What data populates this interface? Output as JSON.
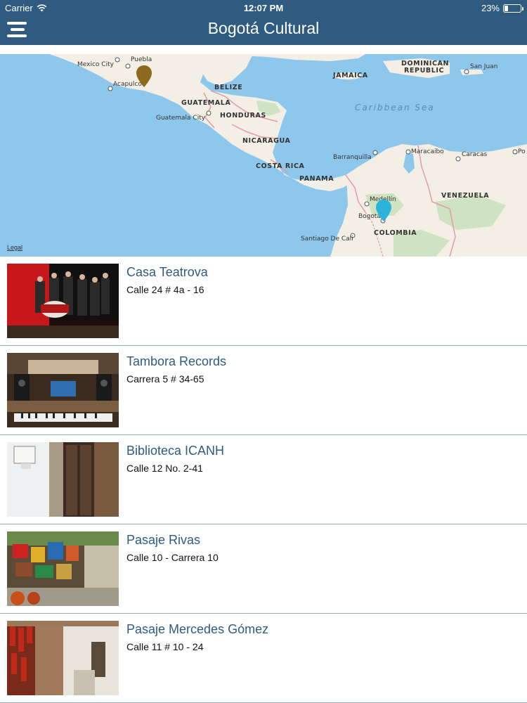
{
  "status_bar": {
    "carrier": "Carrier",
    "time": "12:07 PM",
    "battery": "23%",
    "battery_level": 0.23
  },
  "header": {
    "title": "Bogotá Cultural",
    "menu_icon": "hamburger-menu-icon"
  },
  "map": {
    "legal_label": "Legal",
    "sea_label": "Caribbean Sea",
    "countries": [
      "BELIZE",
      "GUATEMALA",
      "HONDURAS",
      "NICARAGUA",
      "COSTA RICA",
      "PANAMA",
      "JAMAICA",
      "DOMINICAN",
      "REPUBLIC",
      "VENEZUELA",
      "COLOMBIA"
    ],
    "cities": [
      "Mexico City",
      "Puebla",
      "Acapulco",
      "Guatemala City",
      "San Juan",
      "Barranquilla",
      "Maracaibo",
      "Caracas",
      "Po",
      "Medellín",
      "Bogotá",
      "Santiago De Cali"
    ]
  },
  "colors": {
    "header": "#2f5b80",
    "accent_title": "#2f5b80",
    "pin_gold": "#8b6a1e",
    "pin_blue": "#2bb3dc",
    "water": "#8ec7ec",
    "land": "#f3efe4"
  },
  "places": [
    {
      "name": "Casa Teatrova",
      "address": "Calle 24 # 4a - 16"
    },
    {
      "name": "Tambora Records",
      "address": "Carrera 5 # 34-65"
    },
    {
      "name": "Biblioteca ICANH",
      "address": "Calle 12 No. 2-41"
    },
    {
      "name": "Pasaje Rivas",
      "address": "Calle 10 - Carrera 10"
    },
    {
      "name": "Pasaje Mercedes Gómez",
      "address": "Calle 11 # 10 - 24"
    }
  ]
}
